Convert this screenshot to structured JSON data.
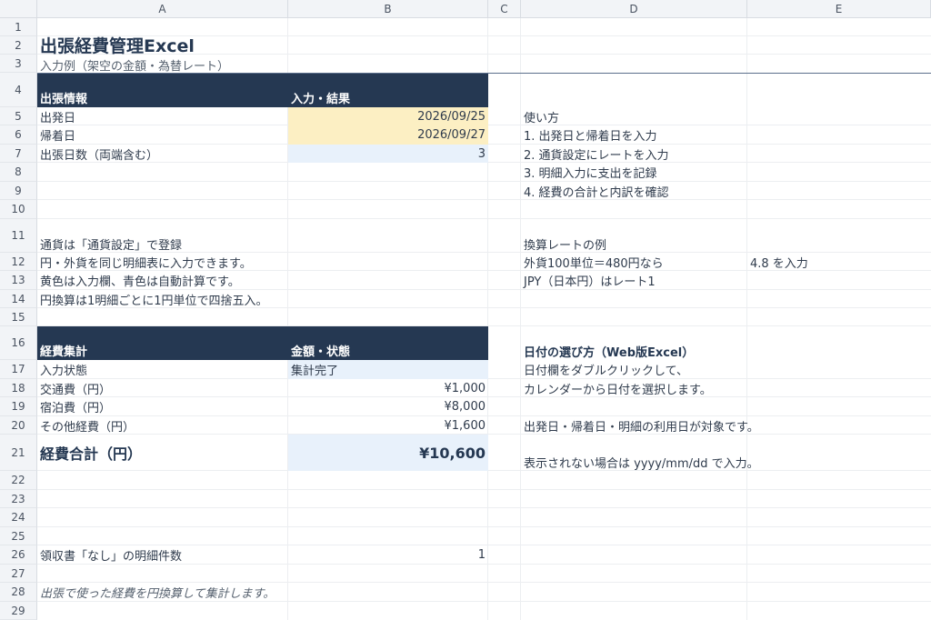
{
  "columns": [
    "A",
    "B",
    "C",
    "D",
    "E"
  ],
  "rows": [
    "1",
    "2",
    "3",
    "4",
    "5",
    "6",
    "7",
    "8",
    "9",
    "10",
    "11",
    "12",
    "13",
    "14",
    "15",
    "16",
    "17",
    "18",
    "19",
    "20",
    "21",
    "22",
    "23",
    "24",
    "25",
    "26",
    "27",
    "28",
    "29"
  ],
  "title": "出張経費管理Excel",
  "subtitle": "入力例（架空の金額・為替レート）",
  "trip": {
    "header_a": "出張情報",
    "header_b": "入力・結果",
    "depart_label": "出発日",
    "depart_value": "2026/09/25",
    "return_label": "帰着日",
    "return_value": "2026/09/27",
    "days_label": "出張日数（両端含む）",
    "days_value": "3"
  },
  "notes": [
    "通貨は「通貨設定」で登録",
    "円・外貨を同じ明細表に入力できます。",
    "黄色は入力欄、青色は自動計算です。",
    "円換算は1明細ごとに1円単位で四捨五入。"
  ],
  "summary": {
    "header_a": "経費集計",
    "header_b": "金額・状態",
    "status_label": "入力状態",
    "status_value": "集計完了",
    "transport_label": "交通費（円）",
    "transport_value": "¥1,000",
    "lodging_label": "宿泊費（円）",
    "lodging_value": "¥8,000",
    "other_label": "その他経費（円）",
    "other_value": "¥1,600",
    "total_label": "経費合計（円）",
    "total_value": "¥10,600"
  },
  "receipt": {
    "label": "領収書「なし」の明細件数",
    "value": "1"
  },
  "footer_note": "出張で使った経費を円換算して集計します。",
  "howto": {
    "title": "使い方",
    "steps": [
      "1. 出発日と帰着日を入力",
      "2. 通貨設定にレートを入力",
      "3. 明細入力に支出を記録",
      "4. 経費の合計と内訳を確認"
    ]
  },
  "rate_example": {
    "title": "換算レートの例",
    "line1": "外貨100単位＝480円なら",
    "line1_e": "4.8 を入力",
    "line2": "JPY（日本円）はレート1"
  },
  "date_help": {
    "title": "日付の選び方（Web版Excel）",
    "line1": "日付欄をダブルクリックして、",
    "line2": "カレンダーから日付を選択します。",
    "line3": "出発日・帰着日・明細の利用日が対象です。",
    "line4": "表示されない場合は yyyy/mm/dd で入力。"
  },
  "colors": {
    "navy": "#253852",
    "yellow": "#fcefc3",
    "blue": "#e8f1fb"
  }
}
